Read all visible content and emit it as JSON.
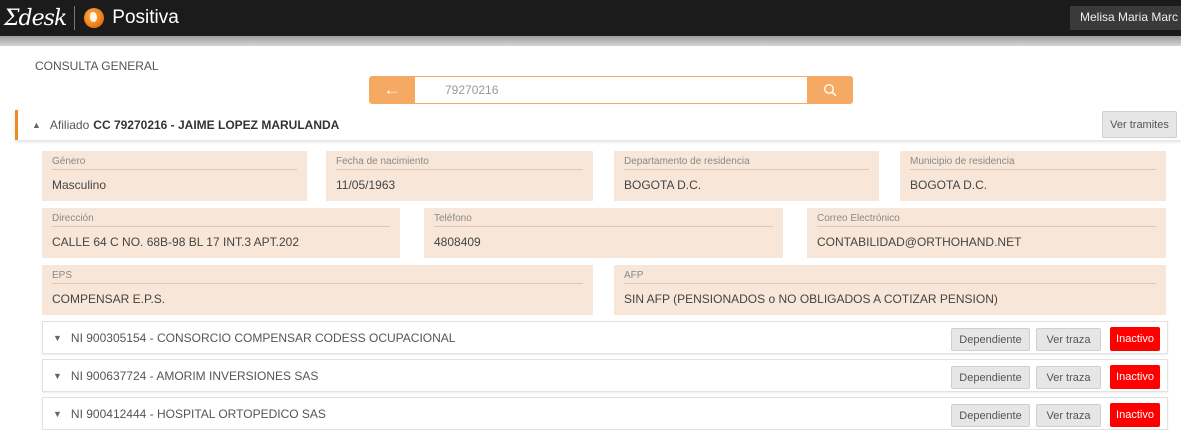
{
  "header": {
    "logo_text": "Σdesk",
    "brand": "Positiva",
    "user": "Melisa Maria Marc"
  },
  "breadcrumb": "CONSULTA GENERAL",
  "search": {
    "back_icon": "arrow-left-icon",
    "value": "79270216",
    "search_icon": "magnifier-icon"
  },
  "afiliado": {
    "label": "Afiliado",
    "value": "CC 79270216 - JAIME LOPEZ MARULANDA",
    "ver_tramites": "Ver tramites"
  },
  "fields": [
    {
      "label": "Género",
      "value": "Masculino"
    },
    {
      "label": "Fecha de nacimiento",
      "value": "11/05/1963"
    },
    {
      "label": "Departamento de residencia",
      "value": "BOGOTA D.C."
    },
    {
      "label": "Municipio de residencia",
      "value": "BOGOTA D.C."
    },
    {
      "label": "Dirección",
      "value": "CALLE 64 C NO. 68B-98 BL 17 INT.3 APT.202"
    },
    {
      "label": "Teléfono",
      "value": "4808409"
    },
    {
      "label": "Correo Electrónico",
      "value": "CONTABILIDAD@ORTHOHAND.NET"
    },
    {
      "label": "EPS",
      "value": "COMPENSAR E.P.S."
    },
    {
      "label": "AFP",
      "value": "SIN AFP (PENSIONADOS o NO OBLIGADOS A COTIZAR PENSION)"
    }
  ],
  "employers": [
    {
      "text": "NI 900305154 - CONSORCIO COMPENSAR CODESS OCUPACIONAL",
      "type": "Dependiente",
      "trace": "Ver traza",
      "status": "Inactivo"
    },
    {
      "text": "NI 900637724 - AMORIM INVERSIONES SAS",
      "type": "Dependiente",
      "trace": "Ver traza",
      "status": "Inactivo"
    },
    {
      "text": "NI 900412444 - HOSPITAL ORTOPEDICO SAS",
      "type": "Dependiente",
      "trace": "Ver traza",
      "status": "Inactivo"
    }
  ],
  "colors": {
    "accent": "#f5a962",
    "accent_dark": "#f08a24",
    "field_bg": "#f8e7d9",
    "inactive": "#ff0000"
  }
}
